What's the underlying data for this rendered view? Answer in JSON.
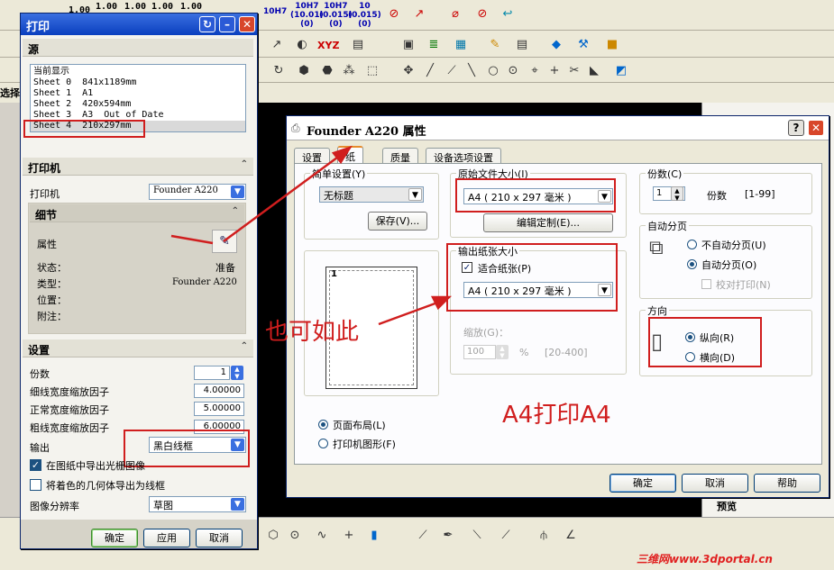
{
  "toolbar": {
    "scale_labels": [
      "1.00",
      "1.00",
      "1.00",
      "1.00",
      "1.00"
    ],
    "tolerance_labels": [
      {
        "top": "10H7",
        "mid": "",
        "bot": ""
      },
      {
        "top": "10H7",
        "mid": "(10.01)",
        "bot": "(0)"
      },
      {
        "top": "10H7",
        "mid": "(0.015)",
        "bot": "(0)"
      },
      {
        "top": "10",
        "mid": "(0.015)",
        "bot": "(0)"
      }
    ],
    "xyz_label": "XYZ",
    "left_label": "选择"
  },
  "print_dialog": {
    "title": "打印",
    "source_section": "源",
    "source_items": [
      "当前显示",
      "Sheet 0  841x1189mm",
      "Sheet 1  A1",
      "Sheet 2  420x594mm",
      "Sheet 3  A3  Out of Date",
      "Sheet 4  210x297mm"
    ],
    "printer_section": "打印机",
    "printer_label": "打印机",
    "printer_value": "Founder A220",
    "details_section": "细节",
    "properties_label": "属性",
    "status_label": "状态：",
    "status_value": "准备",
    "type_label": "类型：",
    "type_value": "Founder A220",
    "location_label": "位置：",
    "comment_label": "附注：",
    "settings_section": "设置",
    "copies_label": "份数",
    "copies_value": "1",
    "thin_label": "细线宽度缩放因子",
    "thin_value": "4.00000",
    "normal_label": "正常宽度缩放因子",
    "normal_value": "5.00000",
    "thick_label": "粗线宽度缩放因子",
    "thick_value": "6.00000",
    "output_label": "输出",
    "output_value": "黑白线框",
    "export_raster_label": "在图纸中导出光栅图像",
    "export_raster_checked": true,
    "shaded_wire_label": "将着色的几何体导出为线框",
    "shaded_wire_checked": false,
    "resolution_label": "图像分辨率",
    "resolution_value": "草图",
    "ok_label": "确定",
    "apply_label": "应用",
    "cancel_label": "取消"
  },
  "founder_dialog": {
    "title": "Founder A220 属性",
    "help_btn": "?",
    "tabs": [
      "设置",
      "纸",
      "质量",
      "设备选项设置"
    ],
    "active_tab": 1,
    "simple_settings_label": "简单设置(Y)",
    "simple_settings_value": "无标题",
    "save_label": "保存(V)...",
    "preview_page_number": "1",
    "page_layout_label": "页面布局(L)",
    "printer_graphic_label": "打印机图形(F)",
    "orig_size_label": "原始文件大小(I)",
    "orig_size_value": "A4 ( 210 x 297 毫米 )",
    "edit_custom_label": "编辑定制(E)...",
    "output_size_label": "输出纸张大小",
    "fit_paper_label": "适合纸张(P)",
    "output_size_value": "A4 ( 210 x 297 毫米 )",
    "zoom_label": "缩放(G)：",
    "zoom_value": "100",
    "zoom_unit": "%",
    "zoom_range": "[20-400]",
    "copies_group": "份数(C)",
    "copies_value": "1",
    "copies_unit": "份数",
    "copies_range": "[1-99]",
    "collate_group": "自动分页",
    "no_collate_label": "不自动分页(U)",
    "collate_label": "自动分页(O)",
    "check_print_label": "校对打印(N)",
    "orientation_group": "方向",
    "portrait_label": "纵向(R)",
    "landscape_label": "横向(D)",
    "ok_label": "确定",
    "cancel_label": "取消",
    "help_label": "帮助"
  },
  "annotations": {
    "also_like_this": "也可如此",
    "a4_to_a4": "A4打印A4"
  },
  "right_panel_label": "预览",
  "watermark": "三维网www.3dportal.cn",
  "colors": {
    "annotation_red": "#d01e1e",
    "title_blue": "#0a3fbf",
    "canvas": "#000000"
  }
}
